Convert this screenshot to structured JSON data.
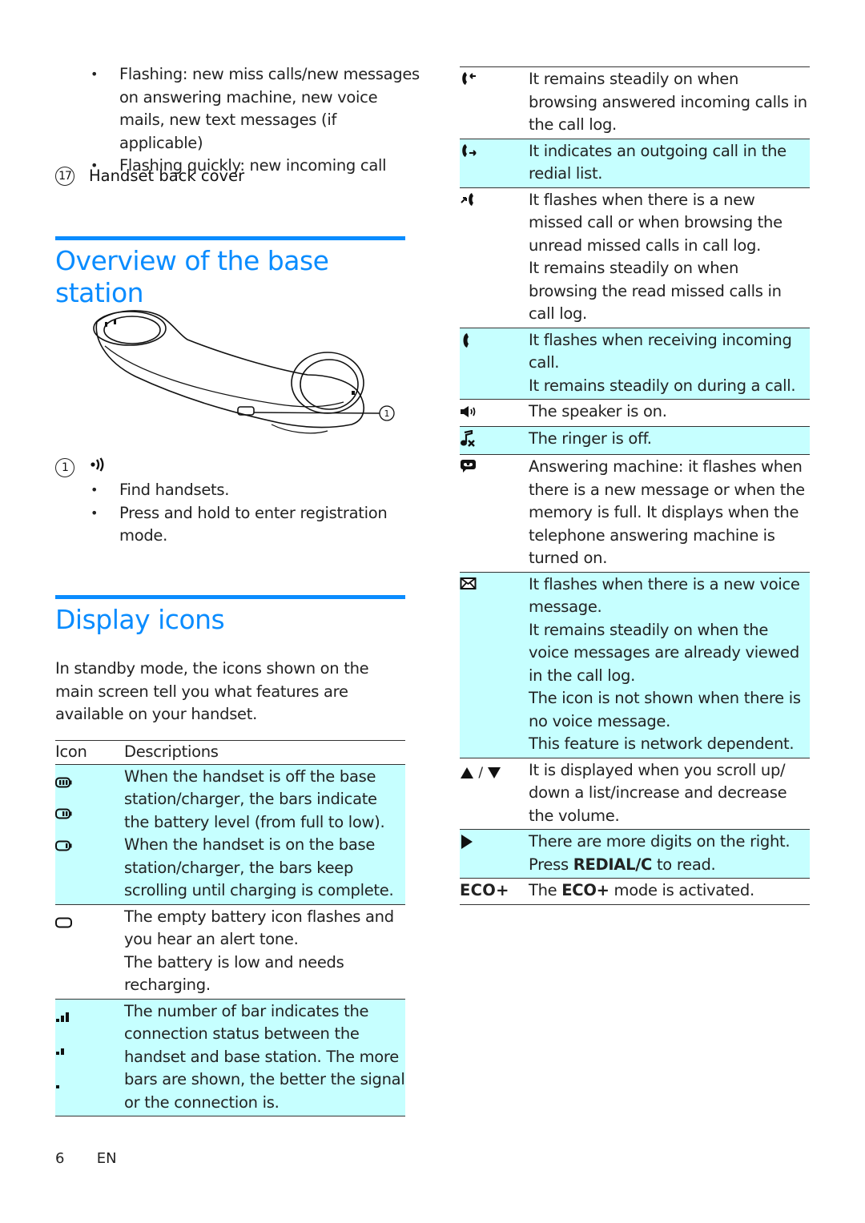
{
  "left": {
    "top_bullets": [
      "Flashing: new miss calls/new messages on answering machine, new voice mails, new text messages (if applicable)",
      "Flashing quickly: new incoming call"
    ],
    "callout_17": {
      "number": "17",
      "label": "Handset back cover"
    },
    "section_base": {
      "title": "Overview of the base station",
      "callout_marker": "1",
      "item": {
        "number": "1",
        "icon": "paging-icon",
        "bullets": [
          "Find handsets.",
          "Press and hold to enter registration mode."
        ]
      }
    },
    "section_display": {
      "title": "Display icons",
      "intro": "In standby mode, the icons shown on the main screen tell you what features are available on your handset.",
      "table_header": {
        "icon": "Icon",
        "desc": "Descriptions"
      }
    }
  },
  "table_rows": [
    {
      "icons": [
        "battery-full-icon",
        "battery-two-bars-icon",
        "battery-one-bar-icon"
      ],
      "highlight": true,
      "lines": [
        "When the handset is off the base station/charger, the bars indicate the battery level (from full to low).",
        "When the handset is on the base station/charger, the bars keep scrolling until charging is complete."
      ]
    },
    {
      "icons": [
        "battery-empty-icon"
      ],
      "highlight": false,
      "lines": [
        "The empty battery icon flashes and you hear an alert tone.",
        "The battery is low and needs recharging."
      ]
    },
    {
      "icons": [
        "signal-three-bars-icon",
        "signal-two-bars-icon",
        "signal-one-bar-icon"
      ],
      "highlight": true,
      "lines": [
        "The number of bar indicates the connection status between the handset and base station. The more bars are shown, the better the signal or the connection is."
      ]
    },
    {
      "icons": [
        "incoming-call-icon"
      ],
      "highlight": false,
      "lines": [
        "It remains steadily on when browsing answered incoming calls in the call log."
      ]
    },
    {
      "icons": [
        "outgoing-call-icon"
      ],
      "highlight": true,
      "lines": [
        "It indicates an outgoing call in the redial list."
      ]
    },
    {
      "icons": [
        "missed-call-icon"
      ],
      "highlight": false,
      "lines": [
        "It flashes when there is a new missed call or when browsing the unread missed calls in call log.",
        "It remains steadily on when browsing the read missed calls in call log."
      ]
    },
    {
      "icons": [
        "phone-call-icon"
      ],
      "highlight": true,
      "lines": [
        "It flashes when receiving incoming call.",
        "It remains steadily on during a call."
      ]
    },
    {
      "icons": [
        "speaker-icon"
      ],
      "highlight": false,
      "lines": [
        "The speaker is on."
      ]
    },
    {
      "icons": [
        "ringer-off-icon"
      ],
      "highlight": true,
      "lines": [
        "The ringer is off."
      ]
    },
    {
      "icons": [
        "answering-machine-icon"
      ],
      "highlight": false,
      "lines": [
        "Answering machine: it flashes when there is a new message or when the memory is full. It displays when the telephone answering machine is turned on."
      ]
    },
    {
      "icons": [
        "voice-message-icon"
      ],
      "highlight": true,
      "lines": [
        "It flashes when there is a new voice message.",
        "It remains steadily on when the voice messages are already viewed in the call log.",
        "The icon is not shown when there is no voice message.",
        "This feature is network dependent."
      ]
    },
    {
      "icons": [
        "scroll-up-icon",
        "scroll-down-icon"
      ],
      "icon_separator": "/",
      "highlight": false,
      "lines": [
        "It is displayed when you scroll up/ down a list/increase and decrease the volume."
      ]
    },
    {
      "icons": [
        "more-digits-icon"
      ],
      "highlight": true,
      "lines": [
        "There are more digits on the right."
      ],
      "line2_prefix": "Press ",
      "line2_bold": "REDIAL/C",
      "line2_suffix": " to read."
    },
    {
      "icons": [
        "eco-plus-icon"
      ],
      "icon_text": "ECO+",
      "highlight": false,
      "line_prefix": "The ",
      "line_bold": "ECO+",
      "line_suffix": " mode is activated."
    }
  ],
  "footer": {
    "page": "6",
    "lang": "EN"
  },
  "colors": {
    "accent": "#0a8cff",
    "highlight_row": "#c6ffff"
  }
}
